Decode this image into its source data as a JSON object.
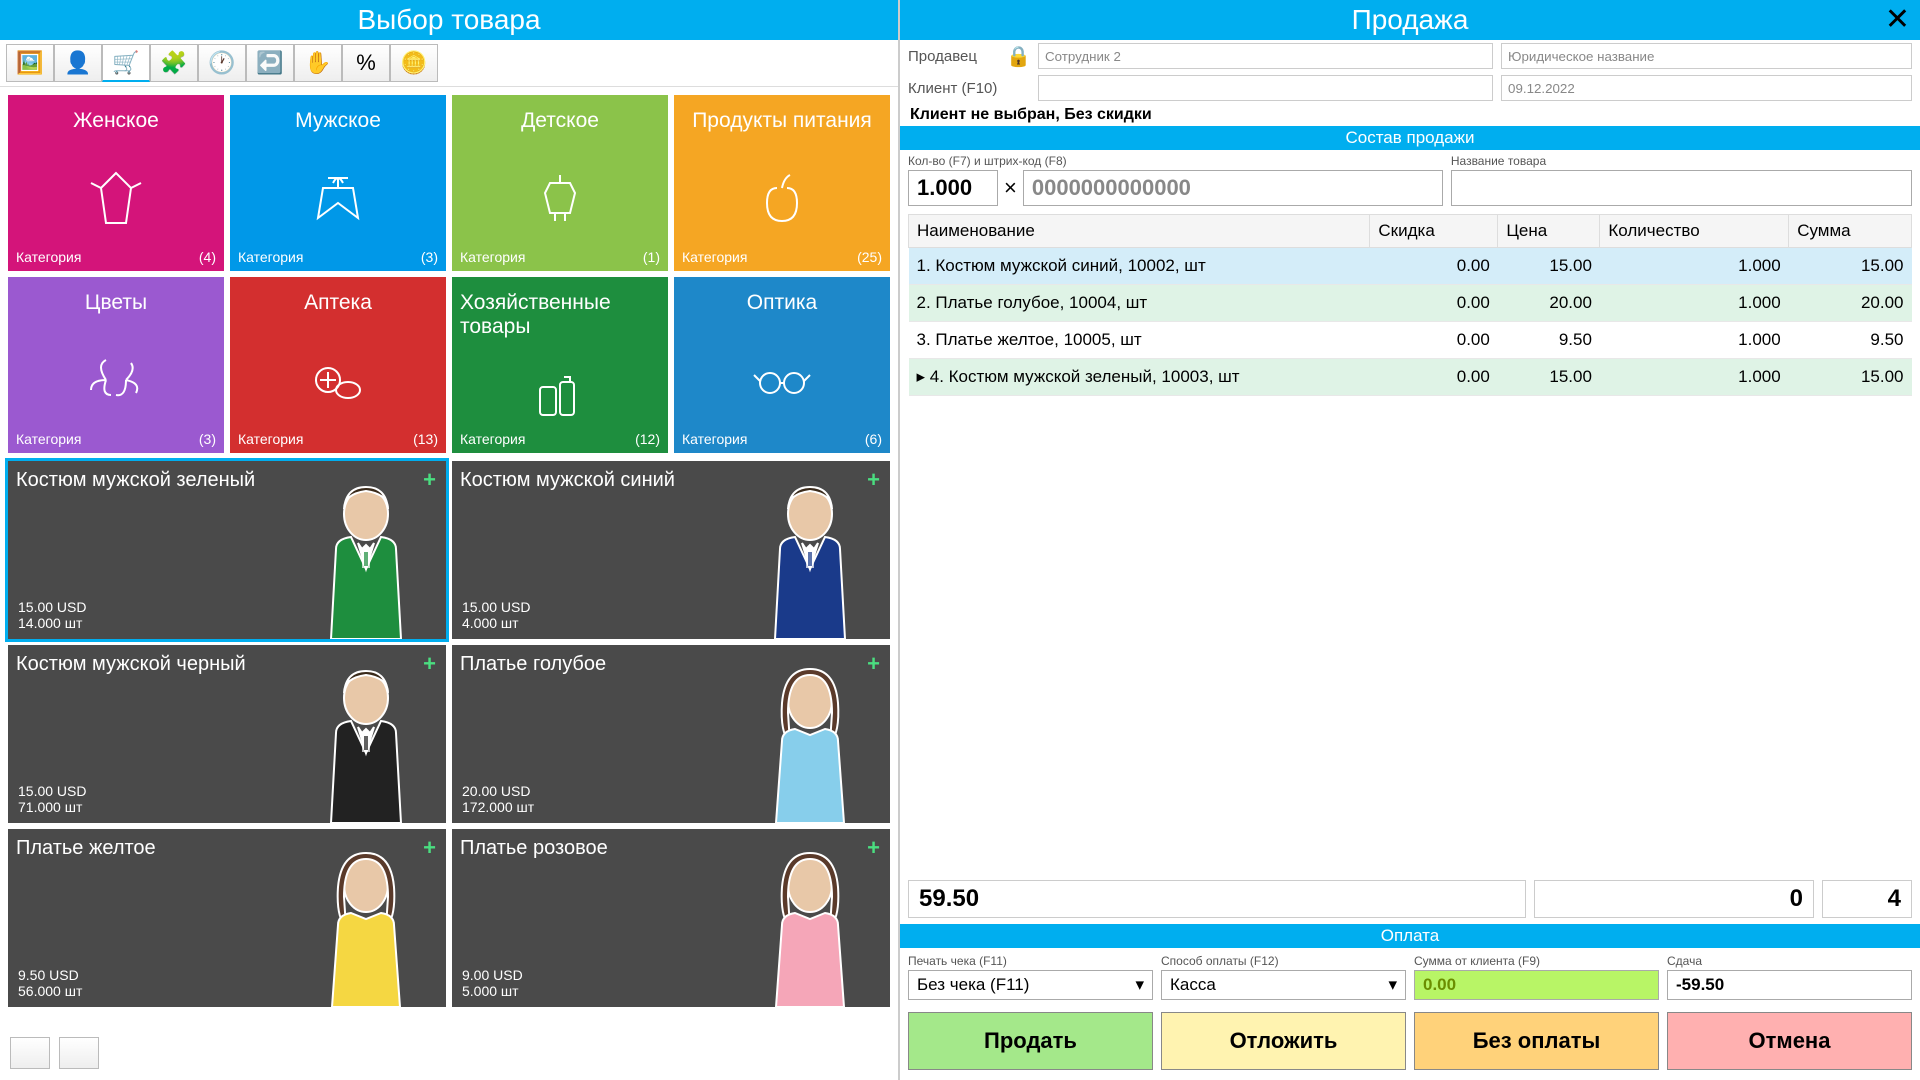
{
  "left_title": "Выбор товара",
  "right_title": "Продажа",
  "seller_label": "Продавец",
  "seller_value": "Сотрудник 2",
  "legal_value": "Юридическое название",
  "client_label": "Клиент (F10)",
  "date_value": "09.12.2022",
  "status": "Клиент не выбран, Без скидки",
  "sale_bar": "Состав продажи",
  "qty_label": "Кол-во (F7) и штрих-код (F8)",
  "name_label": "Название товара",
  "qty_value": "1.000",
  "barcode_value": "0000000000000",
  "cols": {
    "name": "Наименование",
    "discount": "Скидка",
    "price": "Цена",
    "qty": "Количество",
    "sum": "Сумма"
  },
  "rows": [
    {
      "n": "1.",
      "name": "Костюм мужской синий, 10002, шт",
      "d": "0.00",
      "p": "15.00",
      "q": "1.000",
      "s": "15.00"
    },
    {
      "n": "2.",
      "name": "Платье голубое, 10004, шт",
      "d": "0.00",
      "p": "20.00",
      "q": "1.000",
      "s": "20.00"
    },
    {
      "n": "3.",
      "name": "Платье желтое, 10005, шт",
      "d": "0.00",
      "p": "9.50",
      "q": "1.000",
      "s": "9.50"
    },
    {
      "n": "4.",
      "name": "Костюм мужской зеленый, 10003, шт",
      "d": "0.00",
      "p": "15.00",
      "q": "1.000",
      "s": "15.00"
    }
  ],
  "total": "59.50",
  "total2": "0",
  "total3": "4",
  "pay_bar": "Оплата",
  "receipt_label": "Печать чека (F11)",
  "receipt_value": "Без чека (F11)",
  "method_label": "Способ оплаты (F12)",
  "method_value": "Касса",
  "amount_label": "Сумма от клиента (F9)",
  "amount_value": "0.00",
  "change_label": "Сдача",
  "change_value": "-59.50",
  "btn_sell": "Продать",
  "btn_hold": "Отложить",
  "btn_nopay": "Без оплаты",
  "btn_cancel": "Отмена",
  "cat_label": "Категория",
  "cats": [
    {
      "t": "Женское",
      "c": "(4)",
      "bg": "#d4147a"
    },
    {
      "t": "Мужское",
      "c": "(3)",
      "bg": "#0098e8"
    },
    {
      "t": "Детское",
      "c": "(1)",
      "bg": "#8bc34a"
    },
    {
      "t": "Продукты питания",
      "c": "(25)",
      "bg": "#f5a623"
    },
    {
      "t": "Цветы",
      "c": "(3)",
      "bg": "#9b59d0"
    },
    {
      "t": "Аптека",
      "c": "(13)",
      "bg": "#d32f2f"
    },
    {
      "t": "Хозяйственные товары",
      "c": "(12)",
      "bg": "#1e8e3e"
    },
    {
      "t": "Оптика",
      "c": "(6)",
      "bg": "#1e88c9"
    }
  ],
  "prods": [
    {
      "t": "Костюм мужской зеленый",
      "p": "15.00 USD",
      "q": "14.000 шт",
      "sel": true,
      "col": "#1e8e3e"
    },
    {
      "t": "Костюм мужской синий",
      "p": "15.00 USD",
      "q": "4.000 шт",
      "col": "#1a3a8a"
    },
    {
      "t": "Костюм мужской черный",
      "p": "15.00 USD",
      "q": "71.000 шт",
      "col": "#222"
    },
    {
      "t": "Платье голубое",
      "p": "20.00 USD",
      "q": "172.000 шт",
      "col": "#87ceeb"
    },
    {
      "t": "Платье желтое",
      "p": "9.50 USD",
      "q": "56.000 шт",
      "col": "#f5d742"
    },
    {
      "t": "Платье розовое",
      "p": "9.00 USD",
      "q": "5.000 шт",
      "col": "#f5a6b8"
    }
  ]
}
